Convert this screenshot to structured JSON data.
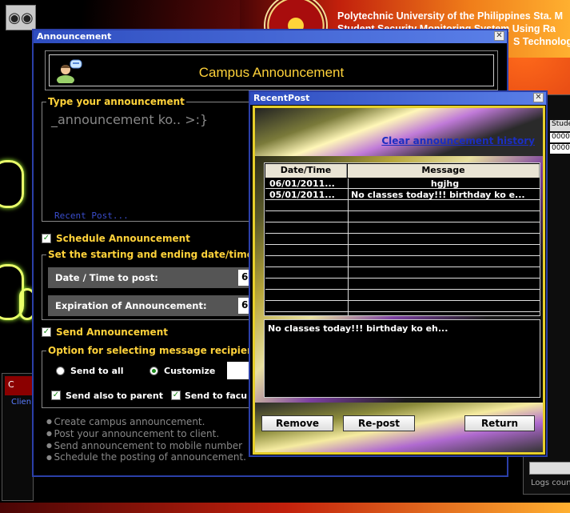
{
  "background": {
    "university_line1": "Polytechnic University of the Philippines Sta. M",
    "university_line2": "Student Security Monitoring System Using Ra",
    "university_line3": "S Technolog",
    "right_header": "Studen",
    "right_cells": [
      "00008",
      "00008"
    ],
    "logs_label": "Logs coun",
    "left_red_label": "C",
    "left_blue_label": "Clien"
  },
  "announcement": {
    "window_title": "Announcement",
    "header_title": "Campus Announcement",
    "type_legend": "Type your announcement",
    "text_value": "_announcement ko.. >:}",
    "recent_post_link": "Recent Post...",
    "schedule_label": "Schedule Announcement",
    "schedule_checked": true,
    "datetime_legend": "Set the starting and ending date/time",
    "date_post_label": "Date / Time to post:",
    "date_post_value": "6",
    "expiration_label": "Expiration of Announcement:",
    "expiration_value": "6",
    "send_label": "Send Announcement",
    "send_checked": true,
    "recipient_legend": "Option for selecting message recipient",
    "radio_all": "Send to all",
    "radio_customize": "Customize",
    "selected_radio": "customize",
    "parent_label": "Send also to parent",
    "parent_checked": true,
    "faculty_label": "Send to facu",
    "faculty_checked": true,
    "tips": [
      "Create campus announcement.",
      "Post your announcement to client.",
      "Send announcement to mobile number",
      "Schedule the posting of announcement."
    ]
  },
  "recent_post": {
    "window_title": "RecentPost",
    "clear_link": "Clear announcement history",
    "col_date": "Date/Time",
    "col_message": "Message",
    "rows": [
      {
        "date": "06/01/2011...",
        "message": "hgjhg"
      },
      {
        "date": "05/01/2011...",
        "message": "No classes today!!! birthday ko e..."
      }
    ],
    "empty_rows": 10,
    "detail_text": "No classes today!!! birthday ko eh...",
    "btn_remove": "Remove",
    "btn_repost": "Re-post",
    "btn_return": "Return"
  },
  "colors": {
    "accent_yellow": "#ffd23a",
    "titlebar_blue": "#2e4dbf",
    "link_blue": "#1b2ec0",
    "frame_gold": "#e6cf2a"
  }
}
